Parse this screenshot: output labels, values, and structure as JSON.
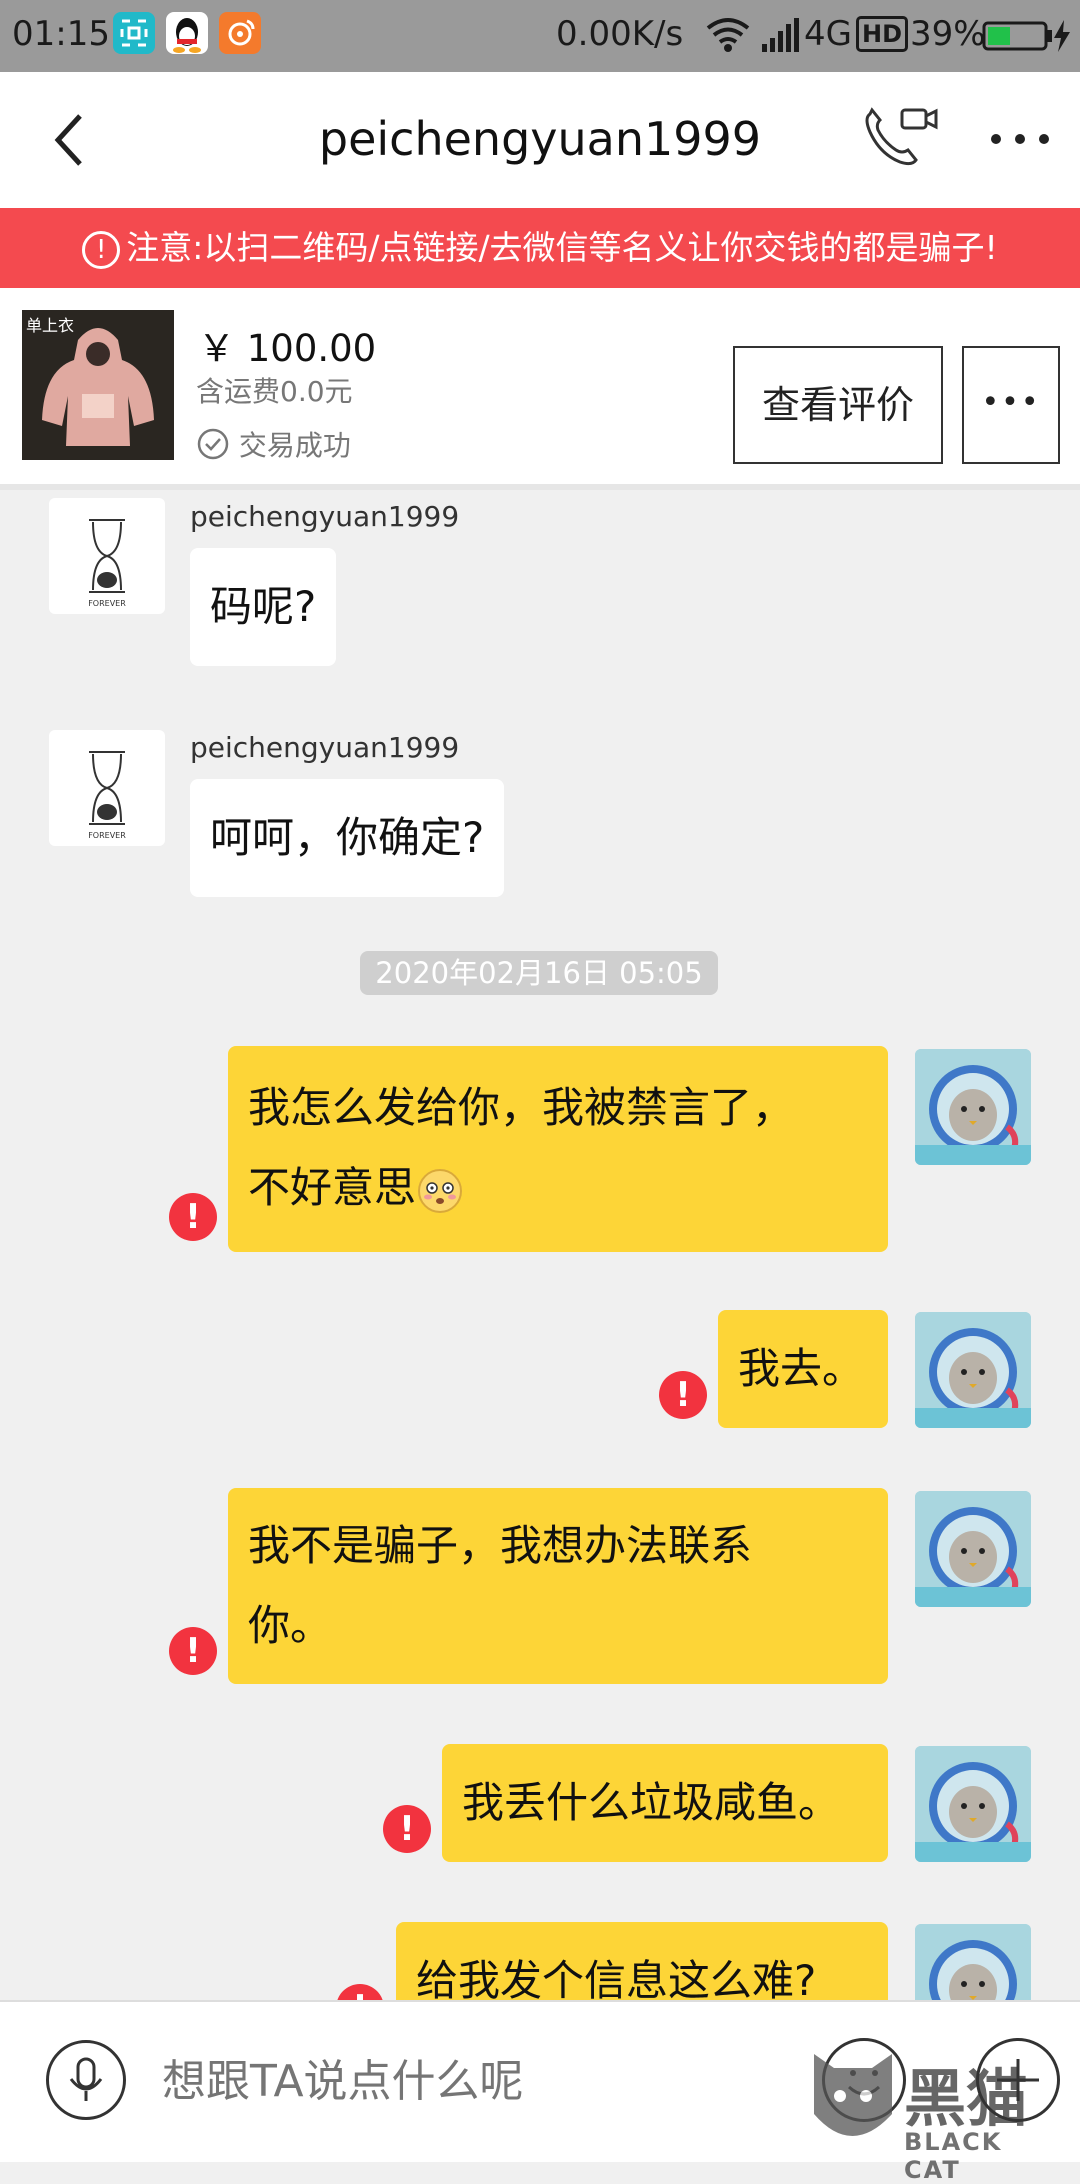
{
  "status_bar": {
    "time": "01:15",
    "network_speed": "0.00K/s",
    "network_type": "4G",
    "hd_label": "HD",
    "battery": "39%",
    "icons": [
      "screenshot-icon",
      "qq-icon",
      "weibo-icon",
      "wifi-icon",
      "signal-icon",
      "battery-icon",
      "charging-icon"
    ]
  },
  "nav": {
    "title": "peichengyuan1999",
    "icons": [
      "back-icon",
      "video-call-icon",
      "more-icon"
    ]
  },
  "warning": {
    "text": "注意:以扫二维码/点链接/去微信等名义让你交钱的都是骗子!"
  },
  "product": {
    "image_text_top": "单上衣",
    "price": "￥ 100.00",
    "shipping": "含运费0.0元",
    "status": "交易成功",
    "review_button": "查看评价",
    "more_button": "•••"
  },
  "messages": {
    "m1": {
      "sender": "peichengyuan1999",
      "text": "码呢?"
    },
    "m2": {
      "sender": "peichengyuan1999",
      "text": "呵呵，你确定?"
    },
    "timestamp": "2020年02月16日 05:05",
    "m3": {
      "line1": "我怎么发给你，我被禁言了，",
      "line2": "不好意思"
    },
    "m4": {
      "text": "我去。"
    },
    "m5": {
      "line1": "我不是骗子，我想办法联系",
      "line2": "你。"
    },
    "m6": {
      "text": "我丢什么垃圾咸鱼。"
    },
    "m7": {
      "text": "给我发个信息这么难?"
    },
    "error_mark": "!"
  },
  "input": {
    "placeholder": "想跟TA说点什么呢"
  },
  "watermark": {
    "text": "黑猫",
    "subtext": "BLACK CAT"
  },
  "colors": {
    "warning_bg": "#f44a4f",
    "my_bubble": "#fdd537",
    "error_red": "#f2333f",
    "status_bar": "#9a9a9a"
  }
}
